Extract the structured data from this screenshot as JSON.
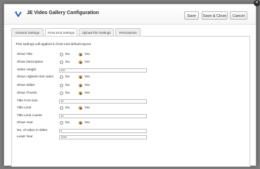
{
  "header": {
    "title": "JE Video Gallery Configuration",
    "buttons": {
      "save": "Save",
      "save_close": "Save & Close",
      "cancel": "Cancel"
    }
  },
  "tabs": [
    {
      "label": "General Settings",
      "active": false
    },
    {
      "label": "Front End Settings",
      "active": true
    },
    {
      "label": "Upload File Settings",
      "active": false
    },
    {
      "label": "Permissions",
      "active": false
    }
  ],
  "note": "This settings will applied in front end default layout.",
  "options": {
    "no": "No",
    "yes": "Yes"
  },
  "rows": [
    {
      "label": "Show Title",
      "type": "radio",
      "value": "Yes"
    },
    {
      "label": "Show Description",
      "type": "radio",
      "value": "Yes"
    },
    {
      "label": "Video Height",
      "type": "text",
      "value": "400"
    },
    {
      "label": "Show Highest Hits video",
      "type": "radio",
      "value": "Yes"
    },
    {
      "label": "Show Slider",
      "type": "radio",
      "value": "Yes"
    },
    {
      "label": "Show Thumb",
      "type": "radio",
      "value": "Yes"
    },
    {
      "label": "Title Font size",
      "type": "text",
      "value": "15"
    },
    {
      "label": "Title Limit",
      "type": "radio",
      "value": "Yes"
    },
    {
      "label": "Title Limit counts",
      "type": "text",
      "value": "15"
    },
    {
      "label": "Show Year",
      "type": "radio",
      "value": "Yes"
    },
    {
      "label": "No. of video in slider",
      "type": "text",
      "value": "4"
    },
    {
      "label": "Least Year",
      "type": "text",
      "value": "1969"
    }
  ]
}
